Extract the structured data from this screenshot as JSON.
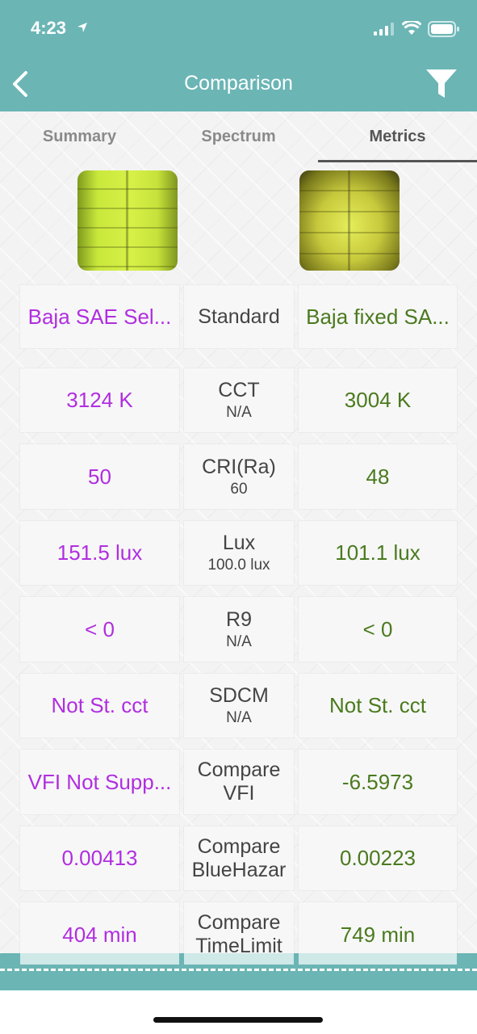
{
  "status_bar": {
    "time": "4:23"
  },
  "nav": {
    "title": "Comparison"
  },
  "tabs": [
    {
      "label": "Summary",
      "active": false
    },
    {
      "label": "Spectrum",
      "active": false
    },
    {
      "label": "Metrics",
      "active": true
    }
  ],
  "colors": {
    "accent": "#6bb5b5",
    "left_value": "#b02ee0",
    "right_value": "#4a7a1e"
  },
  "header_row": {
    "left": "Baja SAE Sel...",
    "middle": "Standard",
    "right": "Baja fixed SA..."
  },
  "rows": [
    {
      "left": "3124 K",
      "name": "CCT",
      "standard": "N/A",
      "right": "3004 K"
    },
    {
      "left": "50",
      "name": "CRI(Ra)",
      "standard": "60",
      "right": "48"
    },
    {
      "left": "151.5 lux",
      "name": "Lux",
      "standard": "100.0 lux",
      "right": "101.1 lux"
    },
    {
      "left": "< 0",
      "name": "R9",
      "standard": "N/A",
      "right": "< 0"
    },
    {
      "left": "Not St. cct",
      "name": "SDCM",
      "standard": "N/A",
      "right": "Not St. cct"
    },
    {
      "left": "VFI Not Supp...",
      "name": "Compare\nVFI",
      "standard": "",
      "right": "-6.5973"
    },
    {
      "left": "0.00413",
      "name": "Compare\nBlueHazar",
      "standard": "",
      "right": "0.00223"
    },
    {
      "left": "404 min",
      "name": "Compare\nTimeLimit",
      "standard": "",
      "right": "749 min"
    }
  ]
}
